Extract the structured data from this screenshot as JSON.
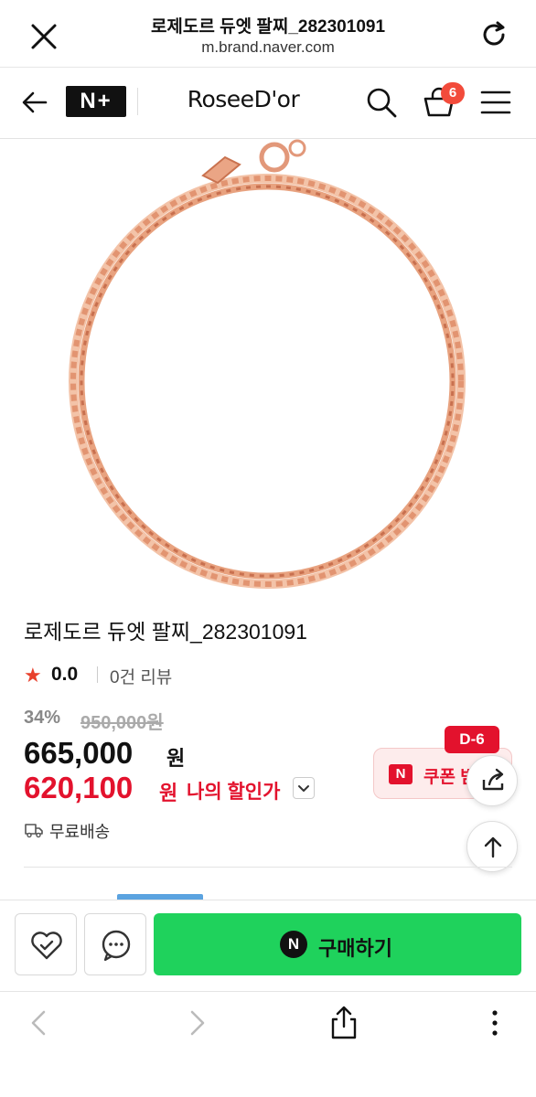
{
  "browser": {
    "title": "로제도르 듀엣 팔찌_282301091",
    "url": "m.brand.naver.com"
  },
  "header": {
    "nplus_label": "N+",
    "brand_name": "RoseeD'or",
    "cart_count": "6"
  },
  "product": {
    "title": "로제도르 듀엣 팔찌_282301091",
    "rating": "0.0",
    "review_count": "0건 리뷰",
    "discount_pct": "34%",
    "original_price": "950,000원",
    "sale_price": "665,000",
    "sale_unit": "원",
    "my_price": "620,100",
    "my_unit": "원",
    "my_price_label": "나의 할인가",
    "shipping": "무료배송"
  },
  "coupon": {
    "badge": "D-6",
    "n_mark": "N",
    "label": "쿠폰 받기"
  },
  "purchase": {
    "buy_n_mark": "N",
    "buy_label": "구매하기"
  },
  "colors": {
    "accent_red": "#e3122d",
    "buy_green": "#1fd25c",
    "rose_gold": "#e8a27f"
  }
}
